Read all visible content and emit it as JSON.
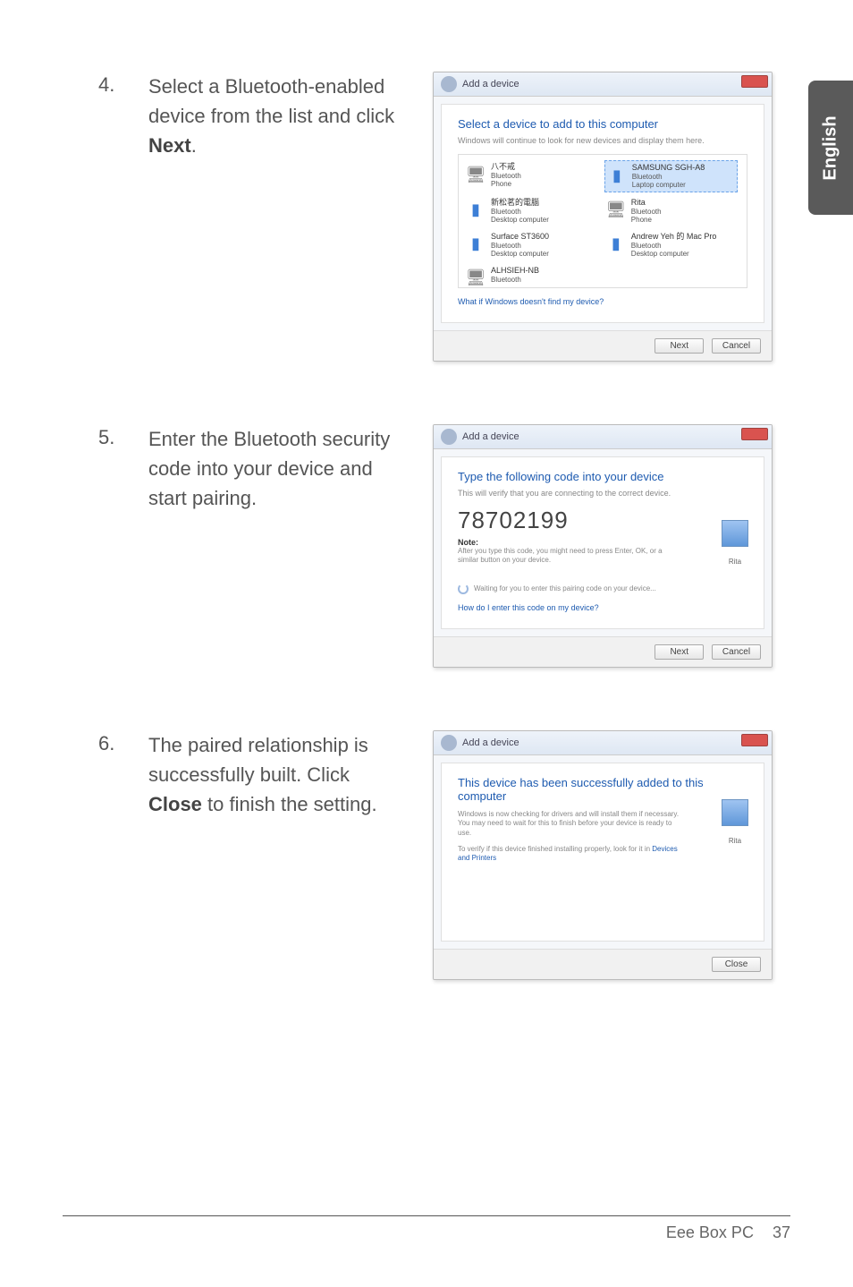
{
  "lang_tab": "English",
  "steps": [
    {
      "num": "4.",
      "text_pre": "Select a Bluetooth-enabled device from the list and click ",
      "text_bold": "Next",
      "text_post": "."
    },
    {
      "num": "5.",
      "text_pre": "Enter the Bluetooth security code into your device and start pairing.",
      "text_bold": "",
      "text_post": ""
    },
    {
      "num": "6.",
      "text_pre": "The paired relationship is successfully built. Click ",
      "text_bold": "Close",
      "text_post": " to finish the setting."
    }
  ],
  "shot1": {
    "window_title": "Add a device",
    "heading": "Select a device to add to this computer",
    "sub": "Windows will continue to look for new devices and display them here.",
    "devices": [
      {
        "name": "八不戒",
        "type": "Bluetooth",
        "detail": "Phone",
        "icon": "pc"
      },
      {
        "name": "SAMSUNG SGH-A8",
        "type": "Bluetooth",
        "detail": "Laptop computer",
        "icon": "bt",
        "selected": true
      },
      {
        "name": "新松茗的電腦",
        "type": "Bluetooth",
        "detail": "Desktop computer",
        "icon": "bt"
      },
      {
        "name": "Rita",
        "type": "Bluetooth",
        "detail": "Phone",
        "icon": "pc"
      },
      {
        "name": "Surface ST3600",
        "type": "Bluetooth",
        "detail": "Desktop computer",
        "icon": "bt"
      },
      {
        "name": "Andrew Yeh 的 Mac Pro",
        "type": "Bluetooth",
        "detail": "Desktop computer",
        "icon": "bt"
      },
      {
        "name": "ALHSIEH-NB",
        "type": "Bluetooth",
        "detail": "",
        "icon": "pc"
      },
      {
        "name": "",
        "type": "",
        "detail": "",
        "icon": ""
      }
    ],
    "link": "What if Windows doesn't find my device?",
    "btn_next": "Next",
    "btn_cancel": "Cancel"
  },
  "shot2": {
    "window_title": "Add a device",
    "heading": "Type the following code into your device",
    "sub": "This will verify that you are connecting to the correct device.",
    "code": "78702199",
    "note_lbl": "Note:",
    "note": "After you type this code, you might need to press Enter, OK, or a similar button on your device.",
    "waiting": "Waiting for you to enter this pairing code on your device...",
    "link": "How do I enter this code on my device?",
    "thumb_lbl": "Rita",
    "btn_next": "Next",
    "btn_cancel": "Cancel"
  },
  "shot3": {
    "window_title": "Add a device",
    "heading": "This device has been successfully added to this computer",
    "body1": "Windows is now checking for drivers and will install them if necessary. You may need to wait for this to finish before your device is ready to use.",
    "body2": "To verify if this device finished installing properly, look for it in ",
    "link": "Devices and Printers",
    "thumb_lbl": "Rita",
    "btn_close": "Close"
  },
  "footer": {
    "title": "Eee Box PC",
    "page": "37"
  }
}
